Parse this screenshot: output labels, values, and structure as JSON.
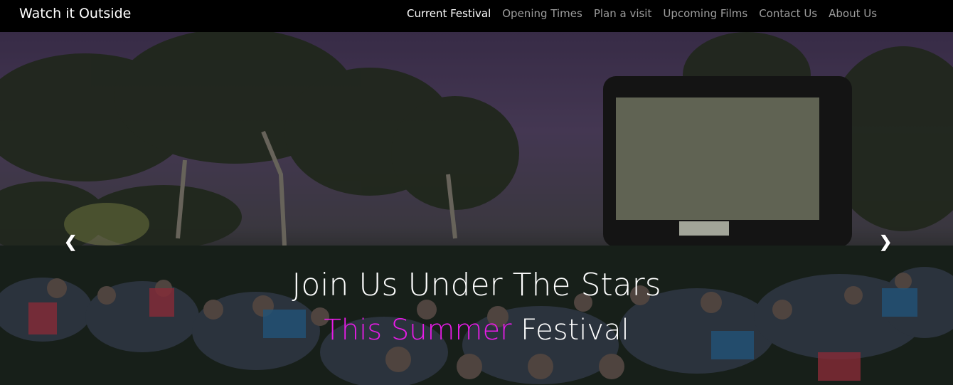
{
  "nav": {
    "brand": "Watch it Outside",
    "links": [
      {
        "label": "Current Festival",
        "active": true
      },
      {
        "label": "Opening Times",
        "active": false
      },
      {
        "label": "Plan a visit",
        "active": false
      },
      {
        "label": "Upcoming Films",
        "active": false
      },
      {
        "label": "Contact Us",
        "active": false
      },
      {
        "label": "About Us",
        "active": false
      }
    ]
  },
  "hero": {
    "title": "Join Us Under The Stars",
    "subtitle_accent": "This Summer",
    "subtitle_rest": "Festival",
    "accent_color": "#e81ce8",
    "prev_icon": "chevron-left-icon",
    "next_icon": "chevron-right-icon"
  }
}
